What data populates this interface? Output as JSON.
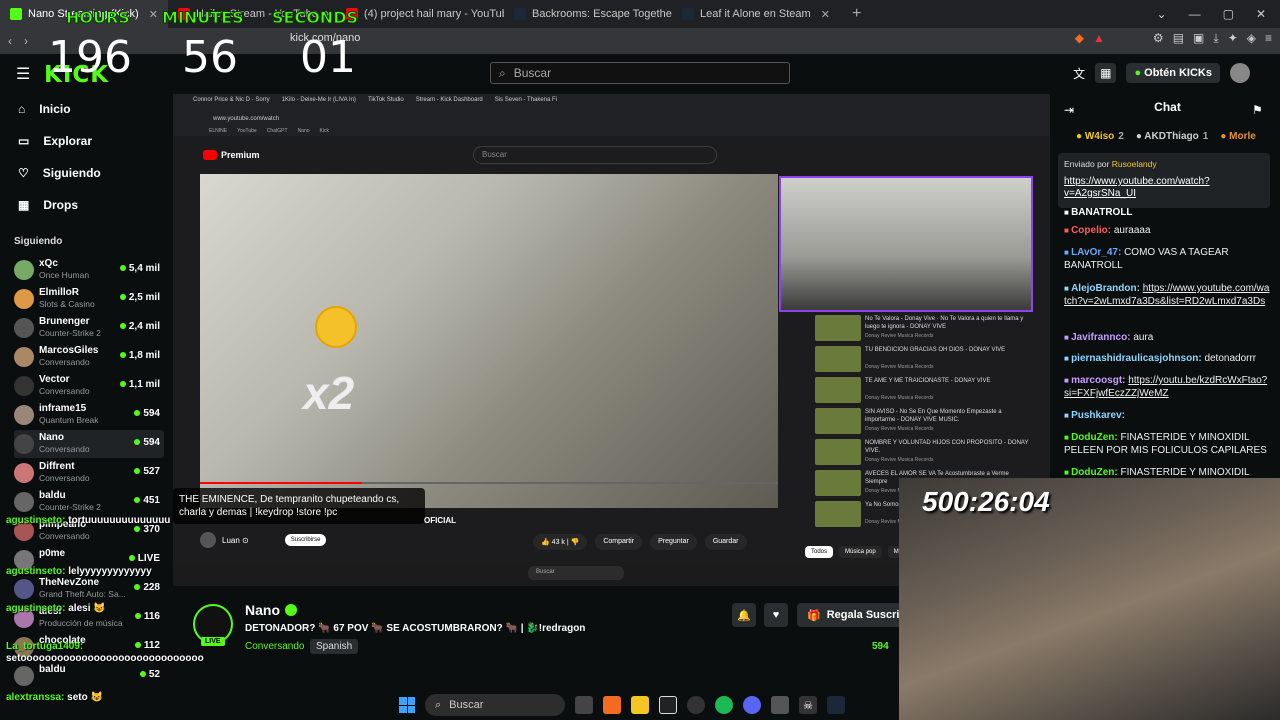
{
  "browser": {
    "tabs": [
      {
        "label": "Nano Streaming (Kick)",
        "color": "#53fc18",
        "active": true
      },
      {
        "label": "Hailey Stream - YouTube",
        "color": "#ff0000",
        "active": false
      },
      {
        "label": "(4) project hail mary - YouTube",
        "color": "#ff0000",
        "active": false
      },
      {
        "label": "Backrooms: Escape Together en Steam",
        "color": "#1b2838",
        "active": false
      },
      {
        "label": "Leaf it Alone en Steam",
        "color": "#1b2838",
        "active": false
      }
    ],
    "url": "kick.com/nano"
  },
  "kick": {
    "search_placeholder": "Buscar",
    "get_kicks": "Obtén KICKs",
    "nav": [
      "Inicio",
      "Explorar",
      "Siguiendo",
      "Drops"
    ],
    "following_title": "Siguiendo",
    "following": [
      {
        "name": "xQc",
        "game": "Once Human",
        "viewers": "5,4 mil"
      },
      {
        "name": "ElmilloR",
        "game": "Slots & Casino",
        "viewers": "2,5 mil"
      },
      {
        "name": "Brunenger",
        "game": "Counter-Strike 2",
        "viewers": "2,4 mil"
      },
      {
        "name": "MarcosGiles",
        "game": "Conversando",
        "viewers": "1,8 mil"
      },
      {
        "name": "Vector",
        "game": "Conversando",
        "viewers": "1,1 mil"
      },
      {
        "name": "inframe15",
        "game": "Quantum Break",
        "viewers": "594"
      },
      {
        "name": "Nano",
        "game": "Conversando",
        "viewers": "594"
      },
      {
        "name": "Diffrent",
        "game": "Conversando",
        "viewers": "527"
      },
      {
        "name": "baldu",
        "game": "Counter-Strike 2",
        "viewers": "451"
      },
      {
        "name": "pimpeano",
        "game": "Conversando",
        "viewers": "370"
      },
      {
        "name": "p0me",
        "game": "",
        "viewers": "LIVE"
      },
      {
        "name": "TheNevZone",
        "game": "Grand Theft Auto: Sa...",
        "viewers": "228"
      },
      {
        "name": "alesi",
        "game": "Producción de música",
        "viewers": "116"
      },
      {
        "name": "chocolate",
        "game": "",
        "viewers": "112"
      },
      {
        "name": "baldu",
        "game": "",
        "viewers": "52"
      }
    ],
    "streamer": {
      "name": "Nano",
      "title": "DETONADOR? 🐂 67 POV 🐂 SE ACOSTUMBRARON? 🐂 | 🐉!redragon",
      "category": "Conversando",
      "language": "Spanish",
      "viewers": "594",
      "gift": "Regala Suscripciones",
      "live": "LIVE"
    }
  },
  "chat": {
    "header": "Chat",
    "gifters": [
      {
        "name": "W4iso",
        "count": "2",
        "color": "#f3c623"
      },
      {
        "name": "AKDThiago",
        "count": "1",
        "color": "#cfcfcf"
      },
      {
        "name": "Morle",
        "count": "",
        "color": "#e88f3a"
      }
    ],
    "pinned_by": "Enviado por",
    "pinned_user": "Rusoelandy",
    "pinned_link": "https://www.youtube.com/watch?v=A2gsrSNa_UI",
    "messages": [
      {
        "user": "BANATROLL",
        "text": "",
        "color": "#ffffff"
      },
      {
        "user": "Copelio:",
        "text": "auraaaa",
        "color": "#ff5c5c"
      },
      {
        "user": "LAvOr_47:",
        "text": "COMO VAS A TAGEAR BANATROLL",
        "color": "#6aa8ff"
      },
      {
        "user": "AlejoBrandon:",
        "text": "https://www.youtube.com/watch?v=2wLmxd7a3Ds&list=RD2wLmxd7a3Ds",
        "color": "#8cd6ff"
      },
      {
        "user": "Javifrannco:",
        "text": "aura",
        "color": "#c99cff"
      },
      {
        "user": "piernashidraulicasjohnson:",
        "text": "detonadorrr",
        "color": "#8cd6ff"
      },
      {
        "user": "marcoosgt:",
        "text": "https://youtu.be/kzdRcWxFtao?si=FXFjwfEczZZjWeMZ",
        "color": "#c99cff"
      },
      {
        "user": "Pushkarev:",
        "text": "",
        "color": "#8cd6ff"
      },
      {
        "user": "DoduZen:",
        "text": "FINASTERIDE Y MINOXIDIL PELEEN POR MIS FOLICULOS CAPILARES",
        "color": "#53fc18"
      },
      {
        "user": "DoduZen:",
        "text": "FINASTERIDE Y MINOXIDIL",
        "color": "#53fc18"
      }
    ]
  },
  "overlay": {
    "timer": {
      "hours_label": "HOURS",
      "minutes_label": "MINUTES",
      "seconds_label": "SECONDS",
      "hours": "196",
      "minutes": "56",
      "seconds": "01"
    },
    "countdown": "500:26:04",
    "subtitle": "THE EMINENCE, De tempranito chupeteando cs, charla y demas | !keydrop !store !pc",
    "oficial": "OFICIAL",
    "chat": [
      {
        "user": "agustinseto:",
        "text": "tortuuuuuuuuuuuuuu"
      },
      {
        "user": "agustinseto:",
        "text": "lelyyyyyyyyyyyyy"
      },
      {
        "user": "agustinseto:",
        "text": "alesi 😺"
      },
      {
        "user": "La_tortuga1409:",
        "text": "setoooooooooooooooooooooooooooooo"
      },
      {
        "user": "alextranssa:",
        "text": "seto 😺"
      }
    ]
  },
  "inner_browser": {
    "tabs": [
      "Connor Price & Nic D - Sorry",
      "1Kilo - Deixe-Me Ir (LIVA In)",
      "TikTok Studio",
      "Stream - Kick Dashboard",
      "Sis Seven - Thakena Fi"
    ],
    "url": "www.youtube.com/watch",
    "bookmarks": [
      "ELNINE",
      "YouTube",
      "ChatGPT",
      "Nano",
      "Kick"
    ],
    "yt_search": "Buscar",
    "yt_brand": "Premium",
    "overlay_text": "x2",
    "channel": "Luan ⊙",
    "subscribe": "Suscribirse",
    "likes": "43 k",
    "share": "Compartir",
    "ask": "Preguntar",
    "save": "Guardar",
    "chips": [
      "Todos",
      "Música pop",
      "Mi"
    ],
    "related": [
      {
        "title": "No Te Valora - Donay Vive · No Te Valora a quien te llama y luego te ignora - DONAY VIVE",
        "channel": "Donay Revive Musica Records"
      },
      {
        "title": "TU BENDICION GRACIAS OH DIOS - DONAY VIVE",
        "channel": "Donay Revive Musica Records"
      },
      {
        "title": "TE AME Y ME TRAICIONASTE - DONAY VIVE",
        "channel": "Donay Revive Musica Records"
      },
      {
        "title": "SIN AVISO - No Se En Que Momento Empezaste a importarme - DONAY VIVE MUSIC.",
        "channel": "Donay Revive Musica Records"
      },
      {
        "title": "NOMBRE Y VOLUNTAD HIJOS CON PROPOSITO - DONAY VIVE.",
        "channel": "Donay Revive Musica Records"
      },
      {
        "title": "AVECES EL AMOR SE VA Te Acostumbraste a Verme Siempre",
        "channel": "Donay Revive Musica Records"
      },
      {
        "title": "Ya No Somos Quedara To",
        "channel": "Donay Revive Musica Records"
      }
    ],
    "taskbar_search": "Buscar"
  },
  "taskbar": {
    "search": "Buscar"
  }
}
